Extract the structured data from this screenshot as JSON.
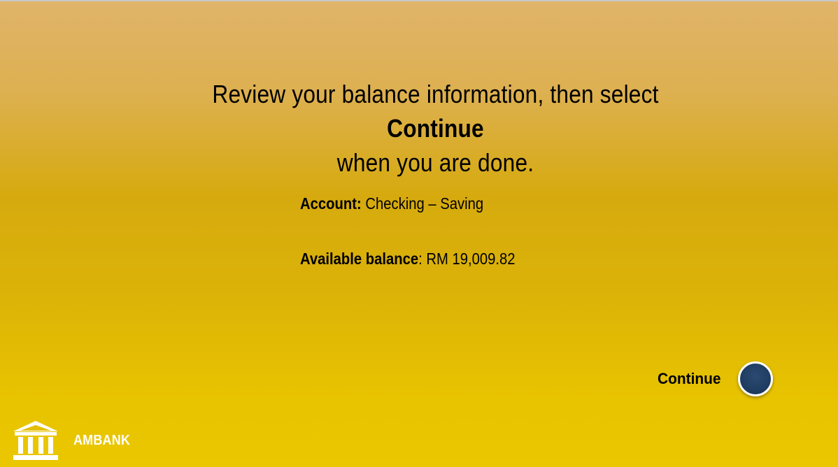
{
  "instruction": {
    "line1_prefix": "Review your balance information, then select ",
    "line1_bold": "Continue",
    "line2": "when you are done."
  },
  "account": {
    "label": "Account:",
    "value": " Checking – Saving"
  },
  "balance": {
    "label": "Available balance",
    "value": ": RM 19,009.82"
  },
  "continue_button": {
    "label": "Continue"
  },
  "brand": {
    "name": "AMBANK",
    "icon": "bank-building-icon"
  },
  "colors": {
    "button_fill": "#1e3a5f",
    "button_border": "#ffffff",
    "brand_text": "#ffffff",
    "background_top": "#e0b46a",
    "background_bottom": "#eac700"
  }
}
